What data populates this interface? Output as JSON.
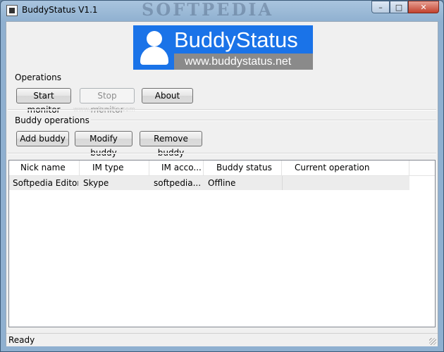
{
  "window": {
    "title": "BuddyStatus V1.1",
    "title_watermark": "SOFTPEDIA",
    "caption": {
      "minimize": "–",
      "maximize": "□",
      "close": "✕"
    }
  },
  "banner": {
    "title": "BuddyStatus",
    "url": "www.buddystatus.net",
    "color": "#1a73e8"
  },
  "operations": {
    "label": "Operations",
    "start": "Start monitor",
    "stop": "Stop monitor",
    "about": "About"
  },
  "buddy_operations": {
    "label": "Buddy operations",
    "add": "Add buddy",
    "modify": "Modify buddy",
    "remove": "Remove buddy"
  },
  "watermark": "www.softpedia.com",
  "table": {
    "columns": [
      "Nick name",
      "IM type",
      "IM acco...",
      "Buddy status",
      "Current operation"
    ],
    "rows": [
      [
        "Softpedia Editor",
        "Skype",
        "softpedia...",
        "Offline",
        ""
      ]
    ]
  },
  "statusbar": {
    "text": "Ready"
  }
}
